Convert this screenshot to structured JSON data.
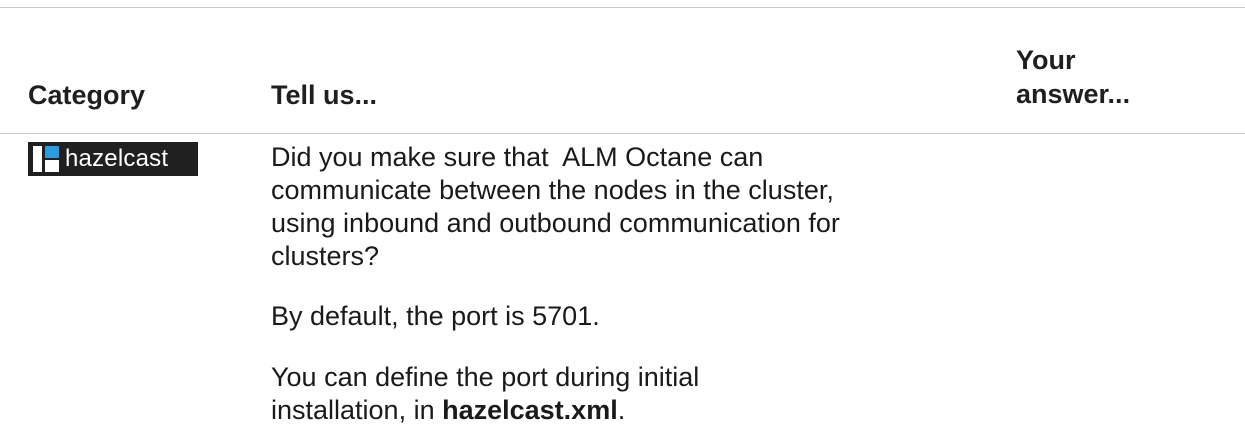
{
  "table": {
    "headers": {
      "category": "Category",
      "tell_us": "Tell us...",
      "your_answer_line1": "Your",
      "your_answer_line2": "answer..."
    },
    "row": {
      "category_logo": {
        "text": "hazelcast",
        "icon": "hazelcast-logo-icon",
        "colors": {
          "background": "#202020",
          "accent": "#2b9be0",
          "mark": "#ffffff"
        }
      },
      "question_line1": "Did you make sure that  ALM Octane can",
      "question_line2": "communicate between the nodes in the cluster,",
      "question_line3": "using inbound and outbound communication for",
      "question_line4": "clusters?",
      "default_port": "By default, the port is 5701.",
      "define_line1": "You can define the port during initial",
      "define_line2_prefix": "installation, in ",
      "define_file": "hazelcast.xml",
      "define_suffix": "."
    }
  }
}
